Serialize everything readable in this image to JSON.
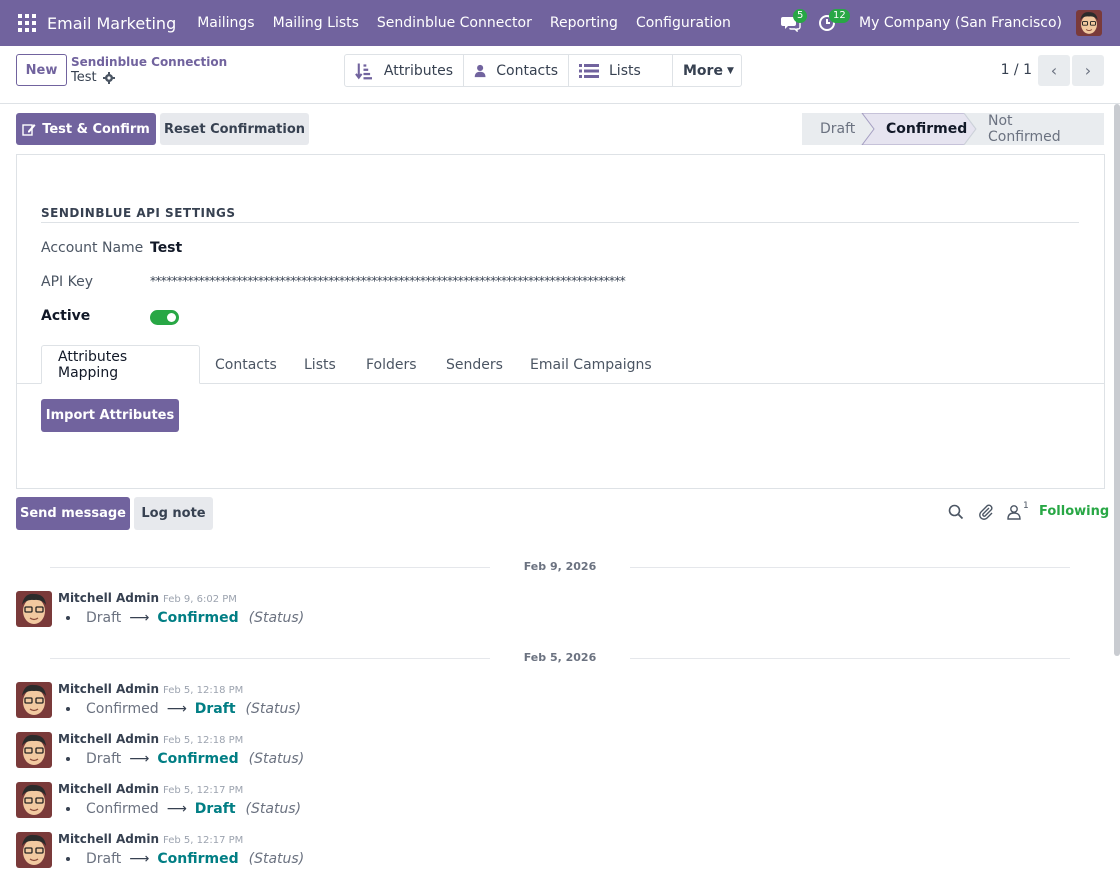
{
  "nav": {
    "brand": "Email Marketing",
    "menu": [
      "Mailings",
      "Mailing Lists",
      "Sendinblue Connector",
      "Reporting",
      "Configuration"
    ],
    "messages_count": "5",
    "activities_count": "12",
    "company": "My Company (San Francisco)"
  },
  "control_panel": {
    "new_label": "New",
    "breadcrumb_parent": "Sendinblue Connection",
    "breadcrumb_current": "Test",
    "smart_buttons": {
      "attributes": "Attributes",
      "contacts": "Contacts",
      "lists": "Lists",
      "more": "More"
    },
    "pager": "1 / 1"
  },
  "statusbar": {
    "test_confirm": "Test & Confirm",
    "reset": "Reset Confirmation",
    "stages": [
      "Draft",
      "Confirmed",
      "Not Confirmed"
    ],
    "active_stage": "Confirmed"
  },
  "form": {
    "section_title": "SENDINBLUE API SETTINGS",
    "account_name_label": "Account Name",
    "account_name_value": "Test",
    "api_key_label": "API Key",
    "api_key_value": "****************************************************************************************",
    "active_label": "Active",
    "active": true,
    "tabs": [
      "Attributes Mapping",
      "Contacts",
      "Lists",
      "Folders",
      "Senders",
      "Email Campaigns"
    ],
    "active_tab": "Attributes Mapping",
    "import_label": "Import Attributes"
  },
  "chatter": {
    "send_label": "Send message",
    "log_label": "Log note",
    "followers_count": "1",
    "following_label": "Following",
    "groups": [
      {
        "date": "Feb 9, 2026",
        "messages": [
          {
            "author": "Mitchell Admin",
            "time": "Feb 9, 6:02 PM",
            "old": "Draft",
            "new": "Confirmed",
            "field": "(Status)"
          }
        ]
      },
      {
        "date": "Feb 5, 2026",
        "messages": [
          {
            "author": "Mitchell Admin",
            "time": "Feb 5, 12:18 PM",
            "old": "Confirmed",
            "new": "Draft",
            "field": "(Status)"
          },
          {
            "author": "Mitchell Admin",
            "time": "Feb 5, 12:18 PM",
            "old": "Draft",
            "new": "Confirmed",
            "field": "(Status)"
          },
          {
            "author": "Mitchell Admin",
            "time": "Feb 5, 12:17 PM",
            "old": "Confirmed",
            "new": "Draft",
            "field": "(Status)"
          },
          {
            "author": "Mitchell Admin",
            "time": "Feb 5, 12:17 PM",
            "old": "Draft",
            "new": "Confirmed",
            "field": "(Status)"
          }
        ]
      }
    ]
  },
  "colors": {
    "brand": "#71639e",
    "success": "#28a745",
    "link": "#017e84"
  }
}
